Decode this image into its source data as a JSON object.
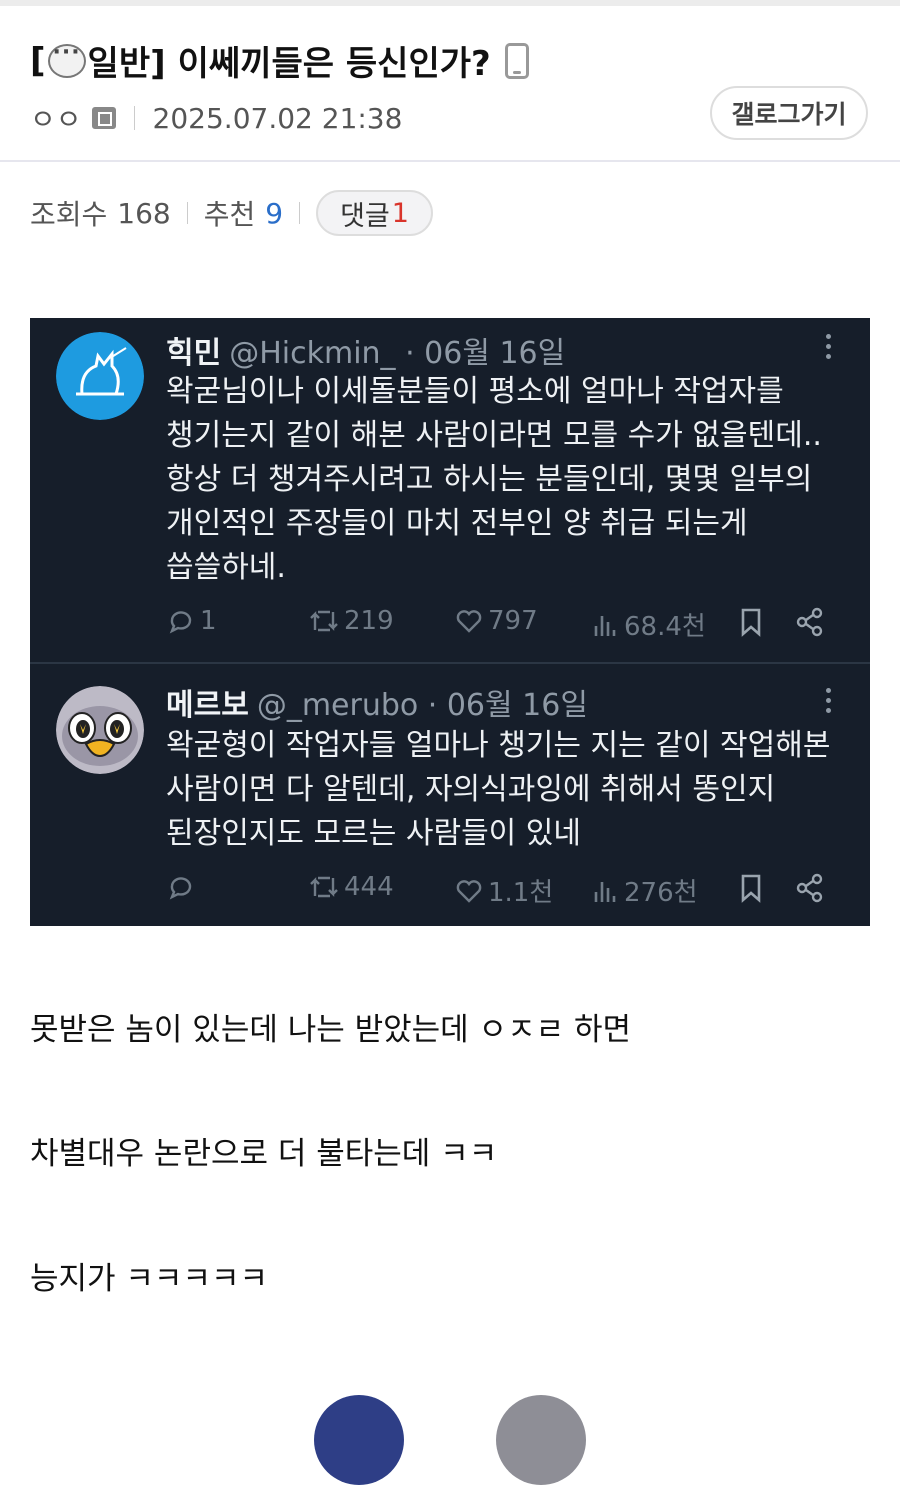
{
  "post": {
    "title_prefix": "[",
    "title_category": "일반]",
    "title_text": "이쎄끼들은 등신인가?",
    "author": "ㅇㅇ",
    "datetime": "2025.07.02 21:38",
    "gallog_button": "갤로그가기",
    "views_label": "조회수",
    "views": "168",
    "recommend_label": "추천",
    "recommend": "9",
    "comments_label": "댓글",
    "comments": "1"
  },
  "tweets": [
    {
      "name": "힉민",
      "handle": "@Hickmin_ · 06월 16일",
      "text": "왁굳님이나 이세돌분들이 평소에 얼마나 작업자를\n챙기는지 같이 해본 사람이라면 모를 수가 없을텐데..\n항상 더 챙겨주시려고 하시는 분들인데, 몇몇 일부의\n개인적인 주장들이 마치 전부인 양 취급 되는게\n씁쓸하네.",
      "replies": "1",
      "retweets": "219",
      "likes": "797",
      "views": "68.4천"
    },
    {
      "name": "메르보",
      "handle": "@_merubo · 06월 16일",
      "text": "왁굳형이 작업자들 얼마나 챙기는 지는 같이 작업해본\n사람이면 다 알텐데, 자의식과잉에 취해서 똥인지\n된장인지도 모르는 사람들이 있네",
      "replies": "",
      "retweets": "444",
      "likes": "1.1천",
      "views": "276천"
    }
  ],
  "body_lines": [
    "못받은 놈이 있는데 나는 받았는데 ㅇㅈㄹ 하면",
    "차별대우 논란으로 더 불타는데 ㅋㅋ",
    "능지가 ㅋㅋㅋㅋㅋ"
  ],
  "icons": {
    "title_category_icon": "speech-bubble-icon",
    "mobile_icon": "phone-icon",
    "gallog_icon": "gallog-badge-icon"
  },
  "colors": {
    "tweet_bg": "#161e2a",
    "recommend_blue": "#2a6ec9",
    "comment_red": "#d9342b"
  }
}
